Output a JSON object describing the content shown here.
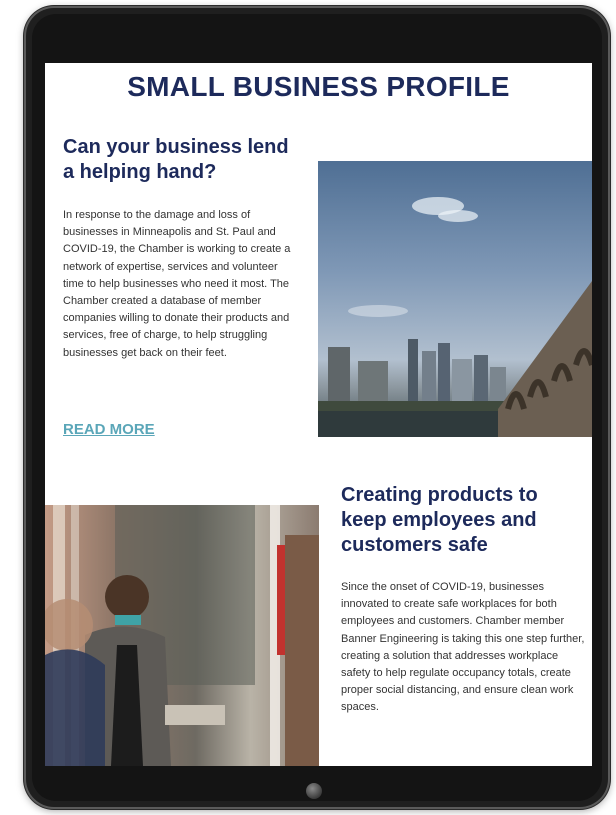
{
  "page": {
    "headline": "SMALL BUSINESS PROFILE"
  },
  "section1": {
    "title": "Can your business lend a helping hand?",
    "body": "In response to the damage and loss of businesses in Minneapolis and St. Paul and COVID-19, the Chamber is working to create a network of expertise, services and volunteer time to help businesses who need it most. The Chamber created a database of member companies willing to donate their products and services, free of charge, to help struggling businesses get back on their feet.",
    "link": "READ MORE",
    "image": "city-skyline-bridge-photo"
  },
  "section2": {
    "title": "Creating products to keep employees and customers safe",
    "body": "Since the onset of COVID-19, businesses innovated to create safe workplaces for both employees and customers. Chamber member Banner Engineering is taking this one step further, creating a solution that addresses workplace safety to help regulate occupancy totals, create proper social distancing, and ensure clean work spaces.",
    "image": "masked-worker-store-photo"
  },
  "colors": {
    "heading": "#1d2a5b",
    "link": "#5aa6b8",
    "device": "#1f1f1f"
  }
}
